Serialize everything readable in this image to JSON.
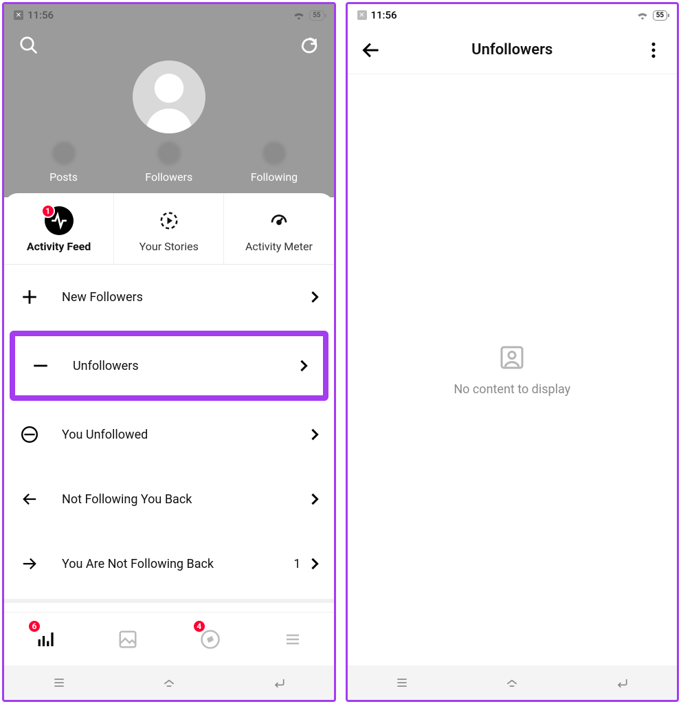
{
  "status": {
    "time": "11:56",
    "battery": "55"
  },
  "left": {
    "stats": {
      "posts": "Posts",
      "followers": "Followers",
      "following": "Following"
    },
    "tabs": [
      {
        "label": "Activity Feed",
        "badge": "1"
      },
      {
        "label": "Your Stories"
      },
      {
        "label": "Activity Meter"
      }
    ],
    "menu": [
      {
        "label": "New Followers"
      },
      {
        "label": "Unfollowers"
      },
      {
        "label": "You Unfollowed"
      },
      {
        "label": "Not Following You Back"
      },
      {
        "label": "You Are Not Following Back",
        "count": "1"
      }
    ],
    "bottombar": {
      "badge1": "6",
      "badge3": "4"
    }
  },
  "right": {
    "title": "Unfollowers",
    "empty": "No content to display"
  }
}
